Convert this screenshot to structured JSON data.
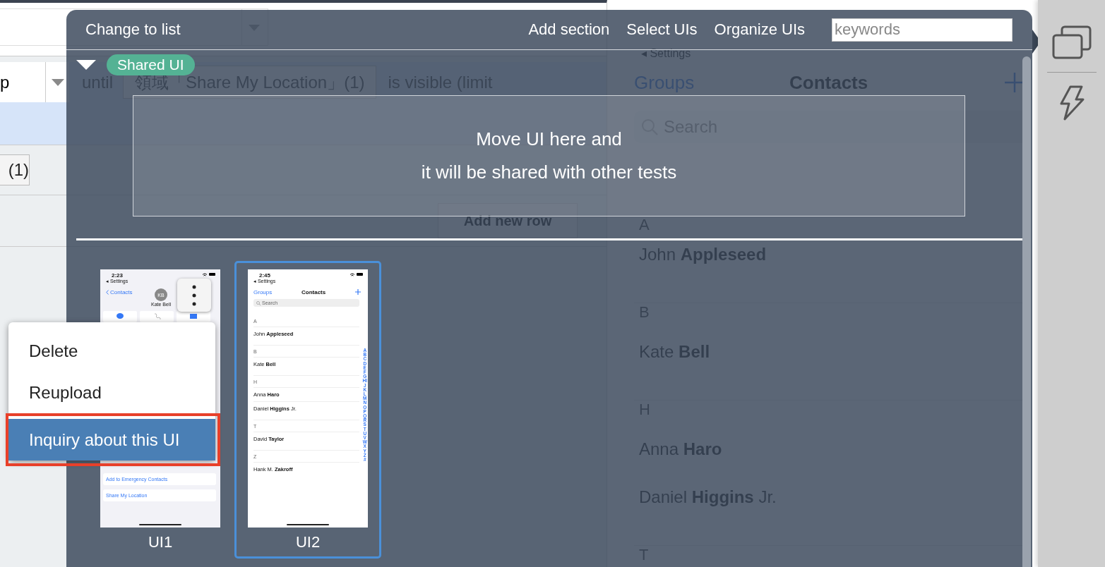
{
  "background_editor": {
    "step_cell": "p",
    "count_button": "(1)",
    "condition": {
      "prefix": "until",
      "element": "領域「Share My Location」(1)",
      "suffix": "is visible (limit"
    },
    "add_row_button": "Add new row"
  },
  "background_preview": {
    "back": "◂ Settings",
    "groups": "Groups",
    "title": "Contacts",
    "search_placeholder": "Search",
    "sections": [
      {
        "letter": "A",
        "contacts": [
          "John **Appleseed**"
        ]
      },
      {
        "letter": "B",
        "contacts": [
          "Kate **Bell**"
        ]
      },
      {
        "letter": "H",
        "contacts": [
          "Anna **Haro**",
          "Daniel **Higgins** Jr."
        ]
      },
      {
        "letter": "T"
      }
    ]
  },
  "panel": {
    "view_toggle": "Change to list",
    "actions": [
      "Add section",
      "Select UIs",
      "Organize UIs"
    ],
    "search": {
      "placeholder": "keywords"
    },
    "sections": [
      {
        "name": "Shared UI",
        "expanded": true,
        "drop_hint": [
          "Move UI here and",
          "it will be shared with other tests"
        ]
      }
    ],
    "uis": [
      {
        "label": "UI1",
        "selected": false,
        "screen": {
          "kind": "contact_detail",
          "time": "2:23",
          "back": "◂ Settings",
          "nav_back": "Contacts",
          "initials": "KB",
          "name": "Kate Bell",
          "options": [
            "Add to Emergency Contacts",
            "Share My Location"
          ]
        }
      },
      {
        "label": "UI2",
        "selected": true,
        "screen": {
          "kind": "contact_list",
          "time": "2:45",
          "back": "◂ Settings",
          "groups": "Groups",
          "title": "Contacts",
          "search_placeholder": "Search",
          "index_letters": "ABCDEFGHIJKLMNOPQRSTUVWXYZ#",
          "sections": [
            {
              "letter": "A",
              "contacts": [
                "John **Appleseed**"
              ]
            },
            {
              "letter": "B",
              "contacts": [
                "Kate **Bell**"
              ]
            },
            {
              "letter": "H",
              "contacts": [
                "Anna **Haro**",
                "Daniel **Higgins** Jr."
              ]
            },
            {
              "letter": "T",
              "contacts": [
                "David **Taylor**"
              ]
            },
            {
              "letter": "Z",
              "contacts": [
                "Hank M. **Zakroff**"
              ]
            }
          ]
        }
      }
    ],
    "context_menu": {
      "items": [
        {
          "label": "Delete",
          "highlighted": false,
          "outlined": false
        },
        {
          "label": "Reupload",
          "highlighted": false,
          "outlined": false
        },
        {
          "label": "Inquiry about this UI",
          "highlighted": true,
          "outlined": true
        }
      ]
    }
  }
}
